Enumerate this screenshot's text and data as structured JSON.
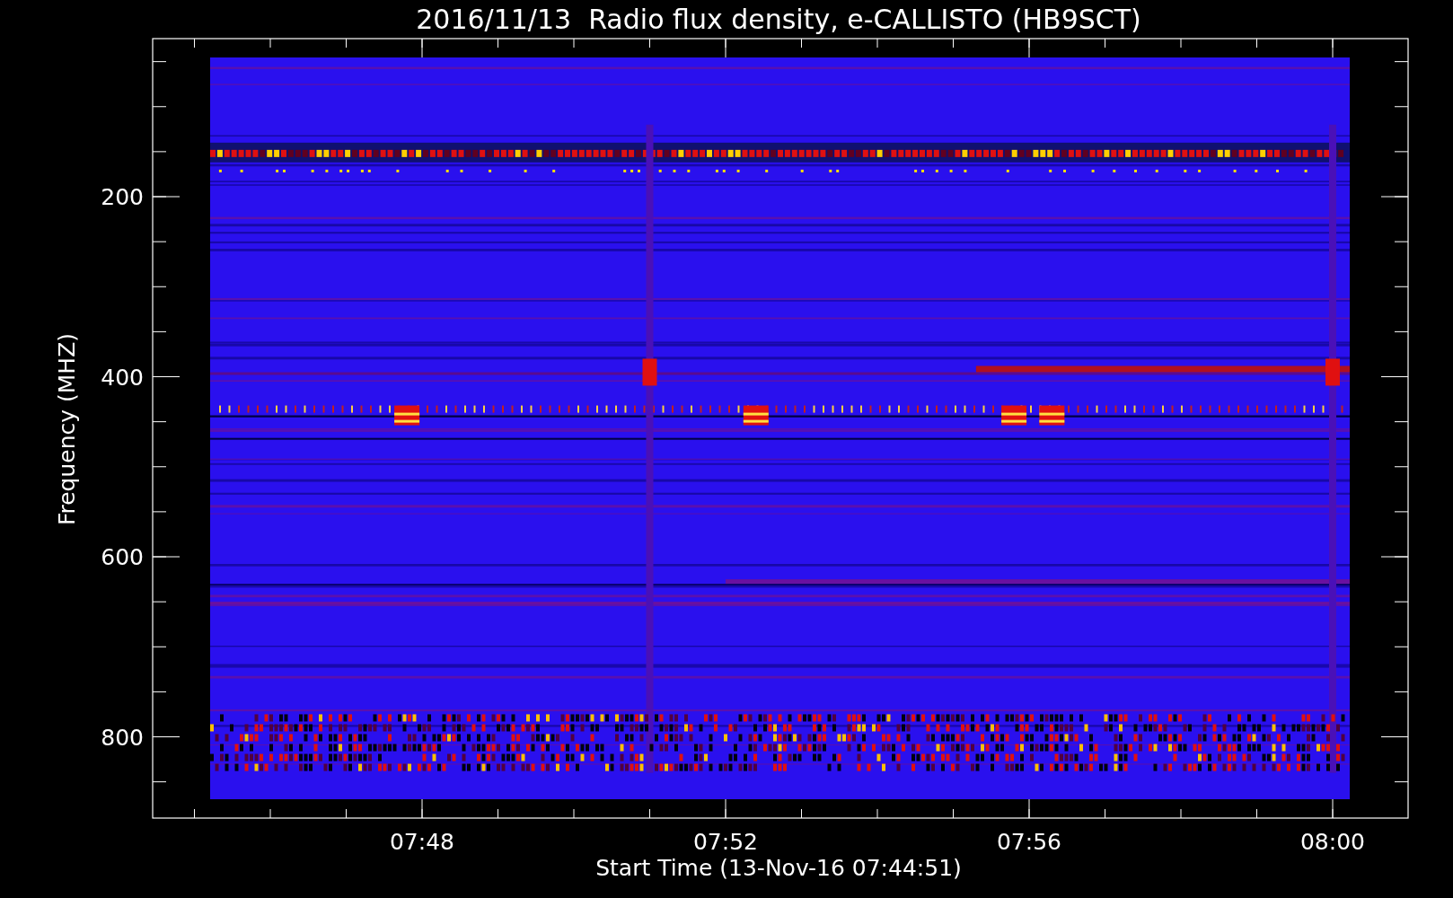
{
  "title": "2016/11/13  Radio flux density, e-CALLISTO (HB9SCT)",
  "x_axis": {
    "label": "Start Time (13-Nov-16 07:44:51)",
    "ticks": [
      "07:48",
      "07:52",
      "07:56",
      "08:00"
    ]
  },
  "y_axis": {
    "label": "Frequency (MHZ)",
    "ticks": [
      "200",
      "400",
      "600",
      "800"
    ]
  }
}
